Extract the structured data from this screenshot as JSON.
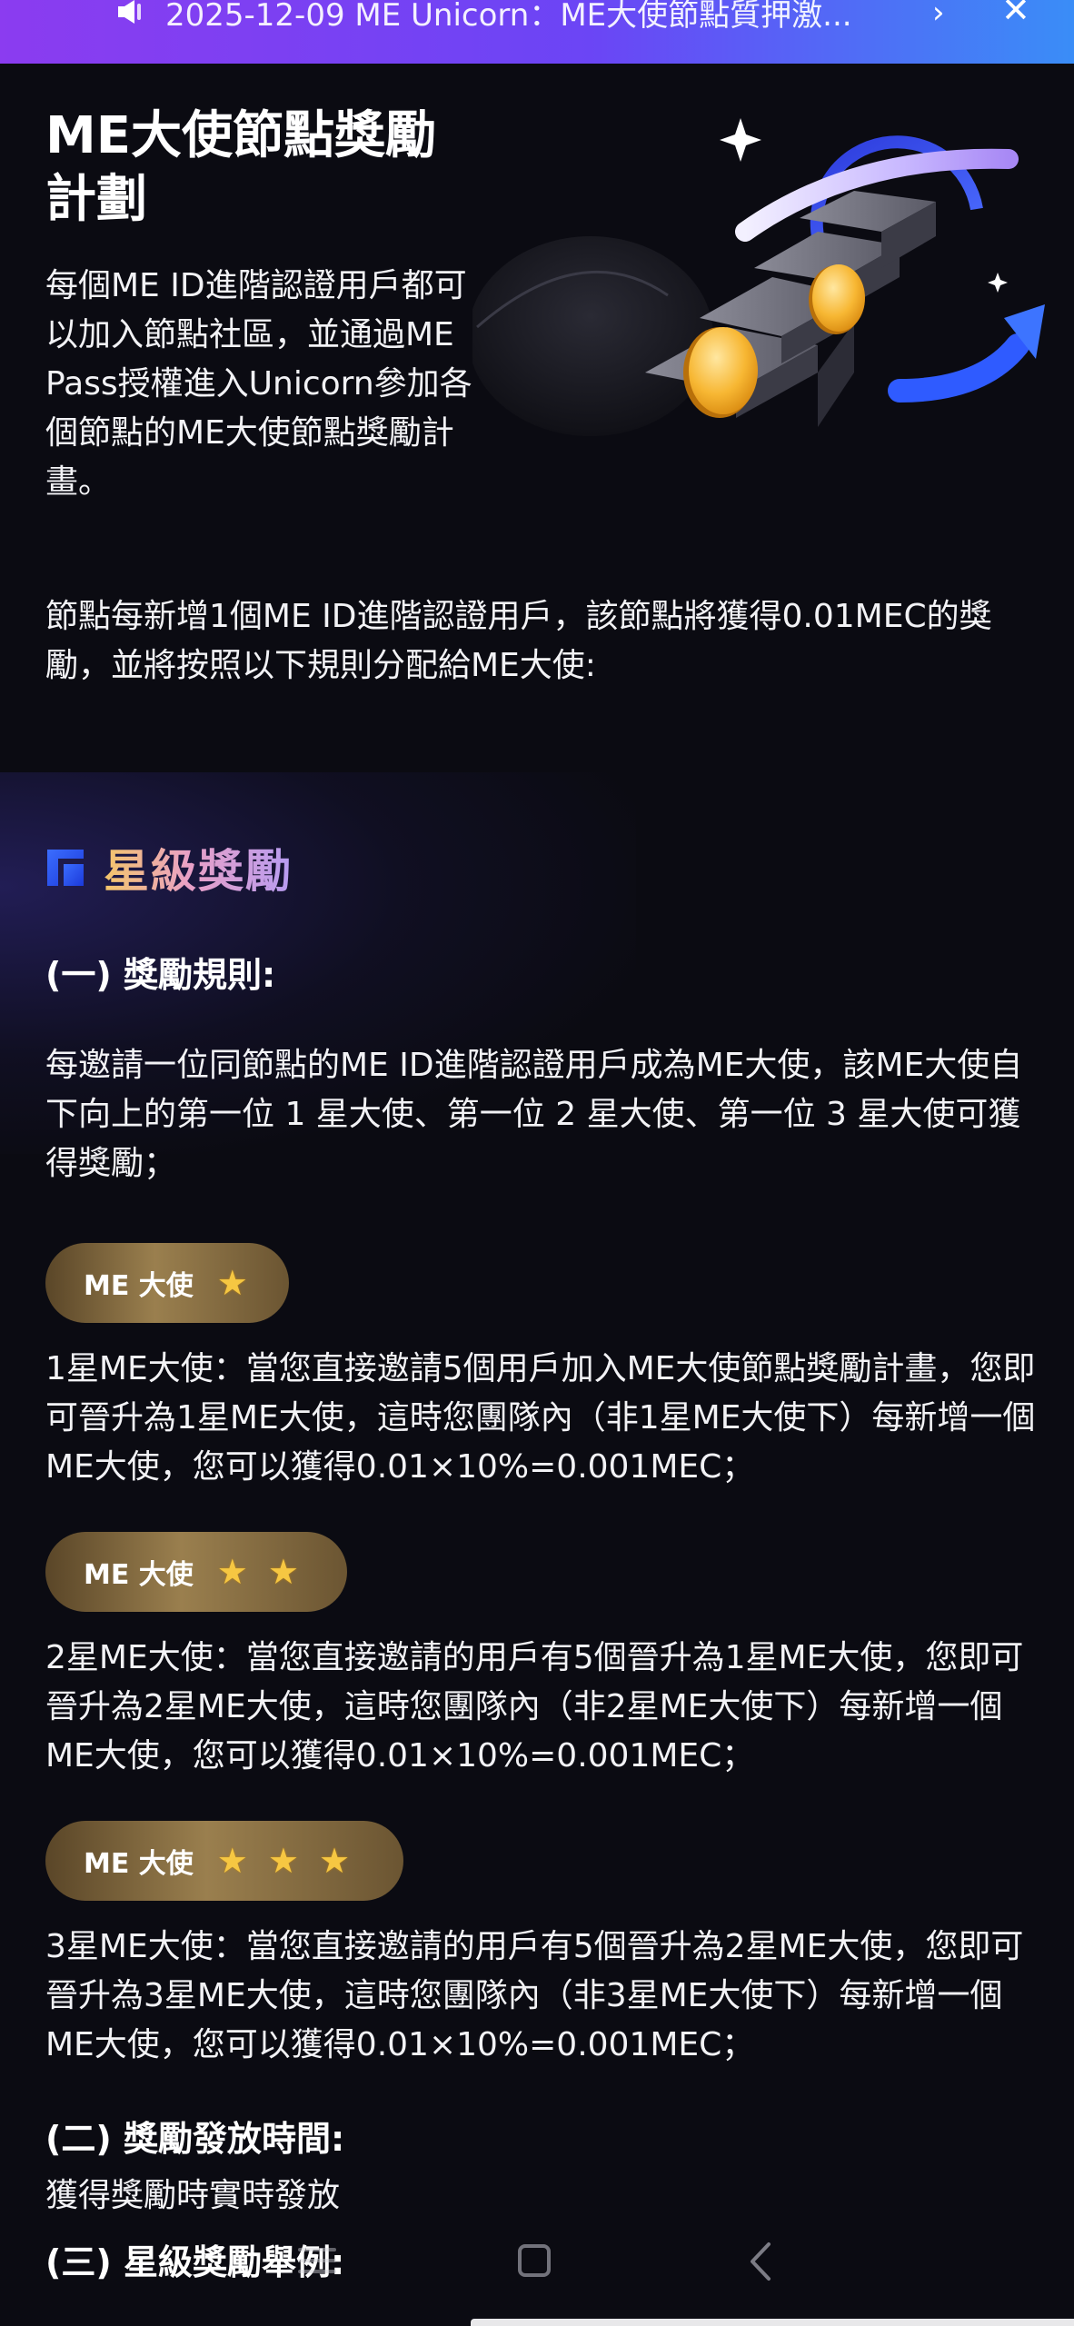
{
  "banner": {
    "text": "2025-12-09 ME Unicorn：ME大使節點質押激...",
    "speaker_icon": "speaker-icon",
    "arrow_icon": "chevron-right-icon",
    "close_icon": "close-icon",
    "arrow_glyph": "›",
    "close_glyph": "✕"
  },
  "hero": {
    "title": "ME大使節點獎勵計劃",
    "description": "每個ME ID進階認證用戶都可以加入節點社區，並通過ME Pass授權進入Unicorn參加各個節點的ME大使節點獎勵計畫。"
  },
  "intro": "節點每新增1個ME ID進階認證用戶，該節點將獲得0.01MEC的獎勵，並將按照以下規則分配給ME大使:",
  "star_reward": {
    "section_title": "星級獎勵",
    "rules_heading": "(一) 獎勵規則:",
    "rules_text": "每邀請一位同節點的ME ID進階認證用戶成為ME大使，該ME大使自下向上的第一位 1 星大使、第一位 2 星大使、第一位 3 星大使可獲得獎勵；",
    "tiers": [
      {
        "badge_label": "ME 大使",
        "stars": 1,
        "description": "1星ME大使：當您直接邀請5個用戶加入ME大使節點獎勵計畫，您即可晉升為1星ME大使，這時您團隊內（非1星ME大使下）每新增一個ME大使，您可以獲得0.01×10%=0.001MEC；"
      },
      {
        "badge_label": "ME 大使",
        "stars": 2,
        "description": "2星ME大使：當您直接邀請的用戶有5個晉升為1星ME大使，您即可晉升為2星ME大使，這時您團隊內（非2星ME大使下）每新增一個ME大使，您可以獲得0.01×10%=0.001MEC；"
      },
      {
        "badge_label": "ME 大使",
        "stars": 3,
        "description": "3星ME大使：當您直接邀請的用戶有5個晉升為2星ME大使，您即可晉升為3星ME大使，這時您團隊內（非3星ME大使下）每新增一個ME大使，您可以獲得0.01×10%=0.001MEC；"
      }
    ],
    "payout_heading": "(二) 獎勵發放時間:",
    "payout_text": "獲得獎勵時實時發放",
    "example_heading": "(三) 星級獎勵舉例:"
  },
  "star_glyph": "★",
  "colors": {
    "banner_start": "#8b3cf0",
    "banner_end": "#3a8df7",
    "background": "#0b0b12",
    "badge_gold": "#9a7f4e",
    "star": "#f6c742"
  },
  "nav": {
    "menu_icon": "menu-icon",
    "home_icon": "home-square-icon",
    "back_icon": "back-chevron-icon"
  }
}
